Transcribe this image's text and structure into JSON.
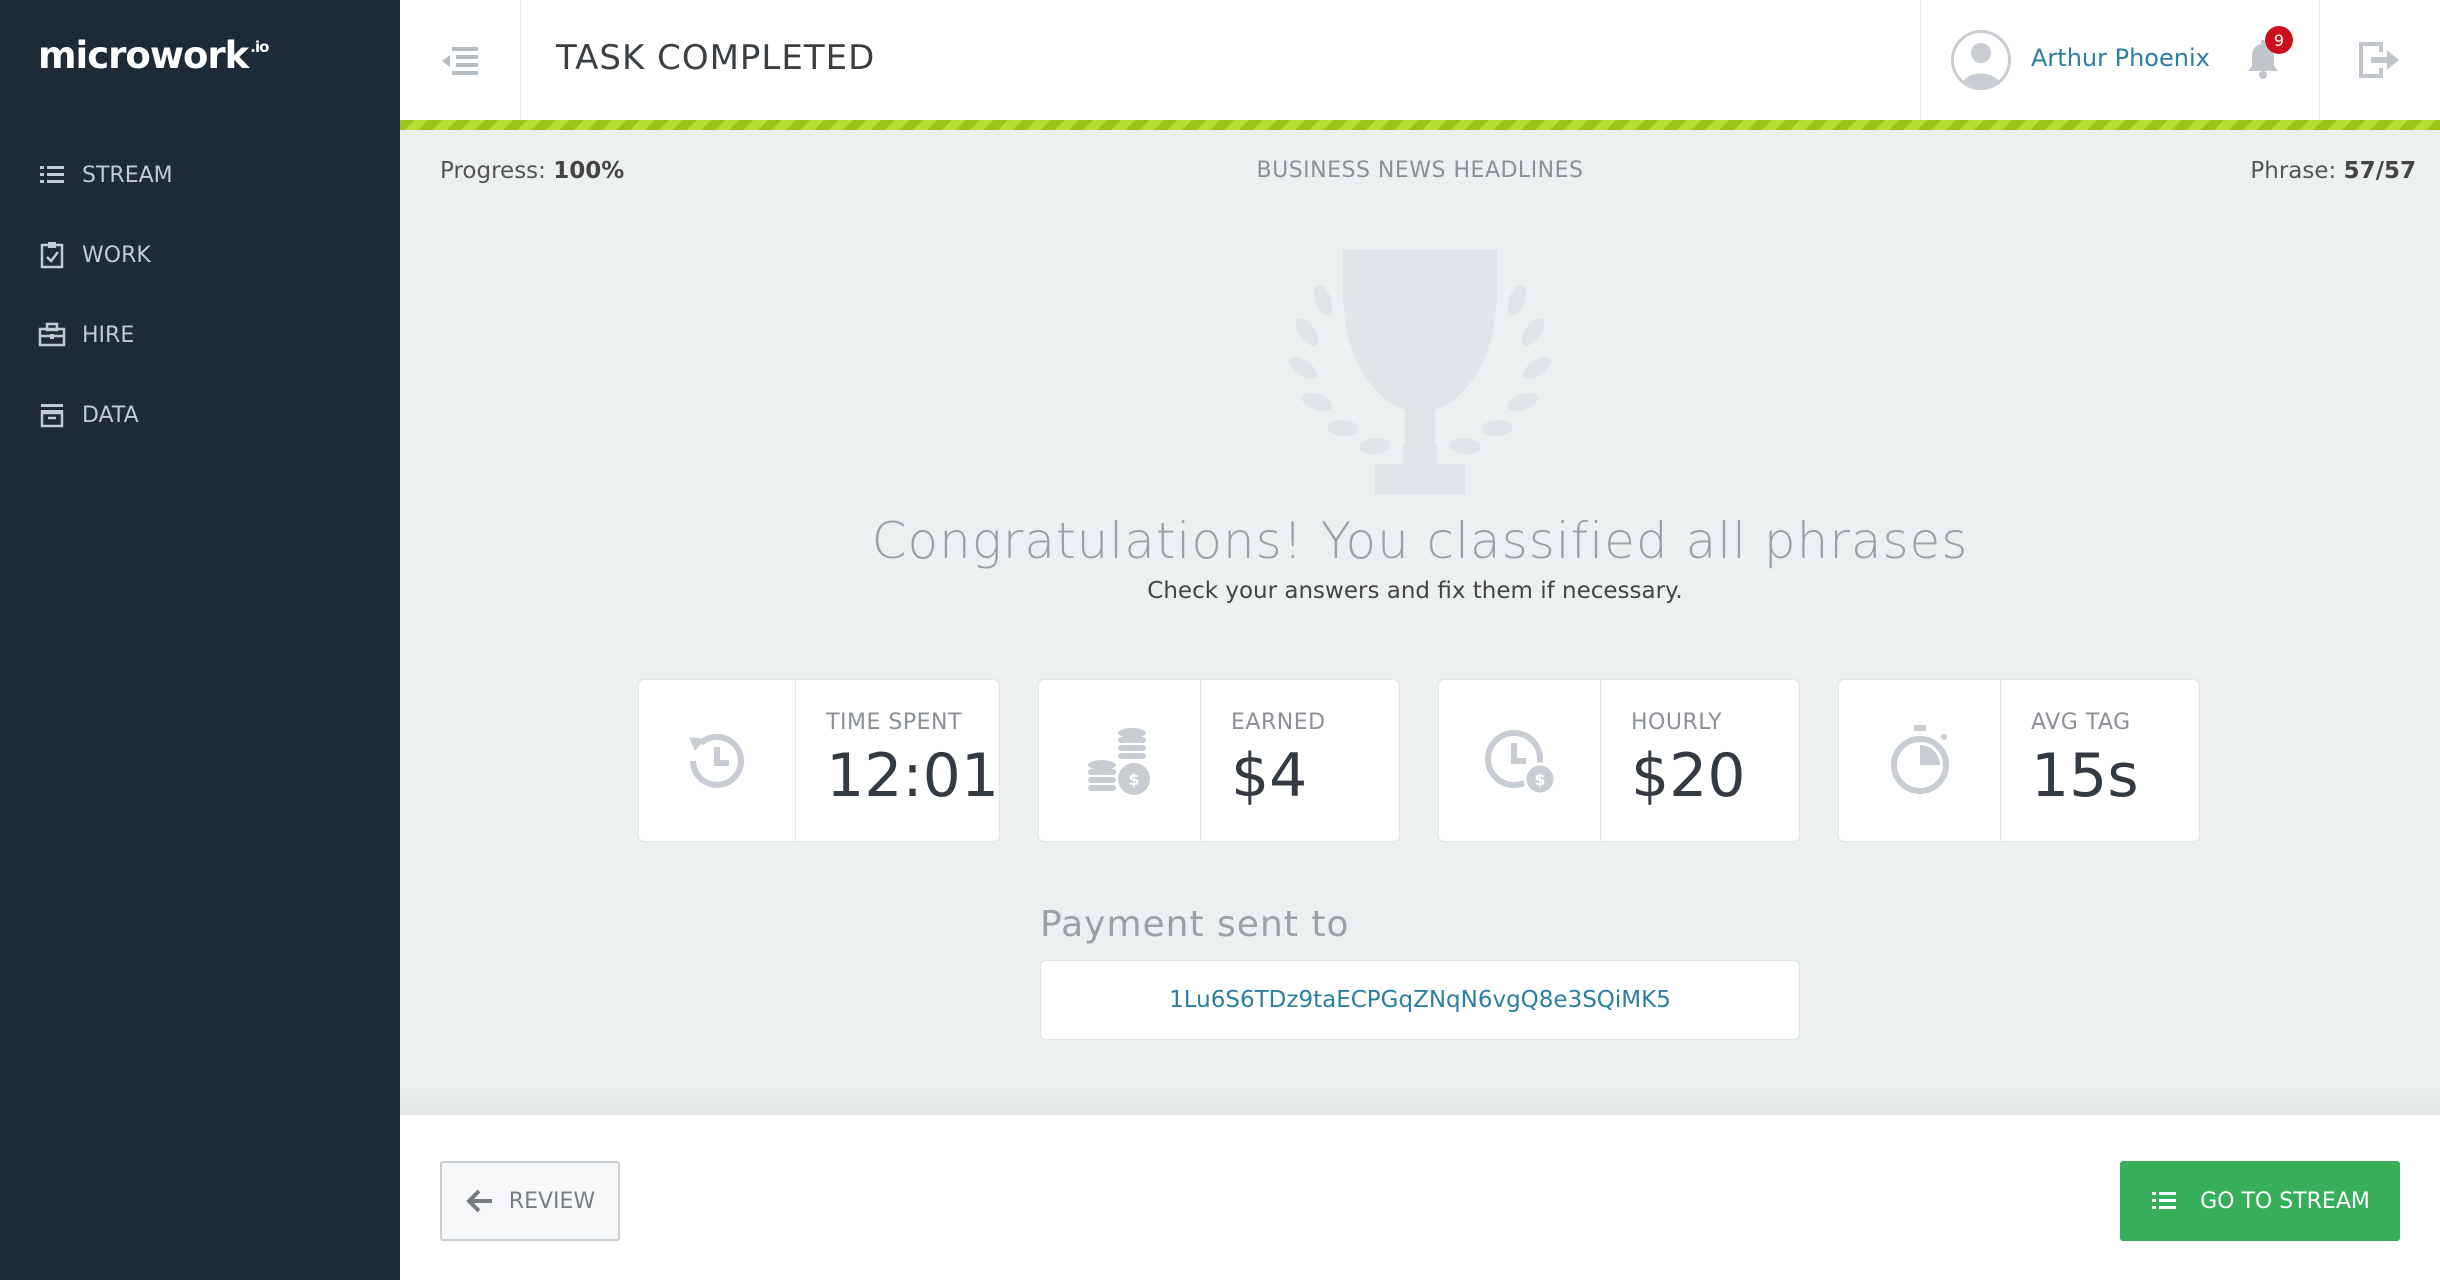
{
  "app": {
    "logo_text": "microwork",
    "logo_suffix": ".io"
  },
  "sidebar": {
    "items": [
      {
        "label": "STREAM",
        "icon": "list-icon"
      },
      {
        "label": "WORK",
        "icon": "clipboard-check-icon"
      },
      {
        "label": "HIRE",
        "icon": "briefcase-icon"
      },
      {
        "label": "DATA",
        "icon": "archive-icon"
      }
    ]
  },
  "header": {
    "title": "TASK COMPLETED",
    "user_name": "Arthur Phoenix",
    "notification_count": "9"
  },
  "task": {
    "progress_label": "Progress:",
    "progress_value": "100%",
    "name": "BUSINESS NEWS HEADLINES",
    "phrase_label": "Phrase:",
    "phrase_value": "57/57"
  },
  "result": {
    "headline": "Congratulations! You classified all phrases",
    "subtext": "Check your answers and fix them if necessary."
  },
  "stats": [
    {
      "label": "TIME SPENT",
      "value": "12:01",
      "icon": "history-clock-icon"
    },
    {
      "label": "EARNED",
      "value": "$4",
      "icon": "coins-icon"
    },
    {
      "label": "HOURLY",
      "value": "$20",
      "icon": "clock-dollar-icon"
    },
    {
      "label": "AVG TAG",
      "value": "15s",
      "icon": "stopwatch-icon"
    }
  ],
  "payment": {
    "label": "Payment sent to",
    "address": "1Lu6S6TDz9taECPGqZNqN6vgQ8e3SQiMK5"
  },
  "footer": {
    "review_label": "REVIEW",
    "stream_label": "GO TO STREAM"
  },
  "colors": {
    "sidebar_bg": "#1e2a36",
    "accent_link": "#2b7fa0",
    "progress_green": "#9cc41a",
    "button_green": "#37ae5a",
    "badge_red": "#cc0f1e"
  }
}
